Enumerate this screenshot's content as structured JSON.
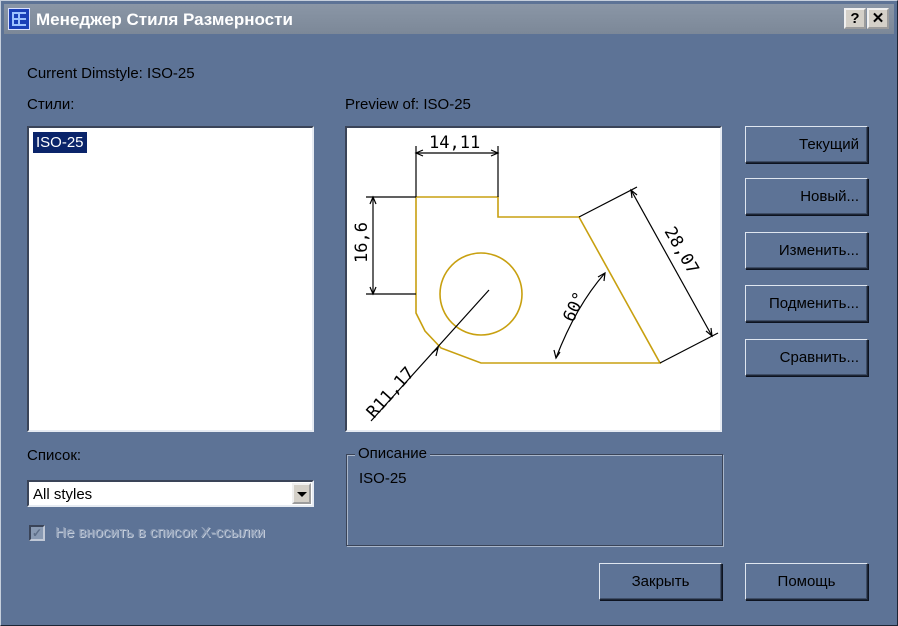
{
  "window": {
    "title": "Менеджер Стиля Размерности",
    "help_button": "?",
    "close_button": "✕"
  },
  "current_dimstyle_label": "Current Dimstyle: ISO-25",
  "styles": {
    "label": "Стили:",
    "items": [
      "ISO-25"
    ]
  },
  "preview": {
    "label": "Preview of: ISO-25",
    "dimensions": {
      "horizontal": "14,11",
      "vertical": "16,6",
      "aligned": "28,07",
      "angle": "60°",
      "radius": "R11,17"
    },
    "colors": {
      "geometry": "#c8a010",
      "dimensions": "#000000"
    }
  },
  "buttons": {
    "current": "Текущий",
    "new": "Новый...",
    "modify": "Изменить...",
    "override": "Подменить...",
    "compare": "Сравнить...",
    "close": "Закрыть",
    "help": "Помощь"
  },
  "list": {
    "label": "Список:",
    "selected": "All styles"
  },
  "xref_checkbox": {
    "label": "Не вносить в список Х-ссылки",
    "checked": true,
    "disabled": true
  },
  "description": {
    "title": "Описание",
    "text": "ISO-25"
  }
}
